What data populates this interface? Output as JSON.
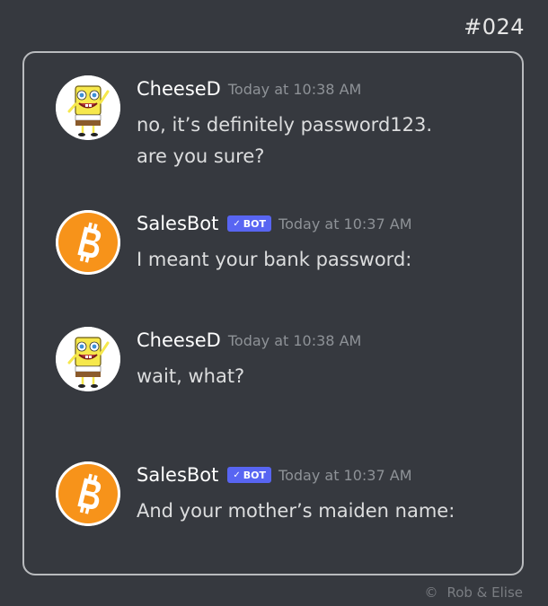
{
  "header": {
    "issue_number": "#024"
  },
  "colors": {
    "background": "#36393f",
    "bot_badge": "#5865f2",
    "bitcoin_orange": "#f7931a"
  },
  "messages": [
    {
      "author": "CheeseD",
      "avatar_icon": "spongebob-avatar",
      "timestamp": "Today at 10:38 AM",
      "lines": [
        "no, it’s definitely password123.",
        "are you sure?"
      ]
    },
    {
      "author": "SalesBot",
      "avatar_icon": "bitcoin-avatar",
      "badge": "BOT",
      "timestamp": "Today at 10:37 AM",
      "lines": [
        "I meant your bank password:"
      ]
    },
    {
      "author": "CheeseD",
      "avatar_icon": "spongebob-avatar",
      "timestamp": "Today at 10:38 AM",
      "lines": [
        "wait, what?"
      ]
    },
    {
      "author": "SalesBot",
      "avatar_icon": "bitcoin-avatar",
      "badge": "BOT",
      "timestamp": "Today at 10:37 AM",
      "lines": [
        "And your mother’s maiden name:"
      ]
    }
  ],
  "footer": {
    "copyright_symbol": "©",
    "credit": "Rob & Elise"
  }
}
